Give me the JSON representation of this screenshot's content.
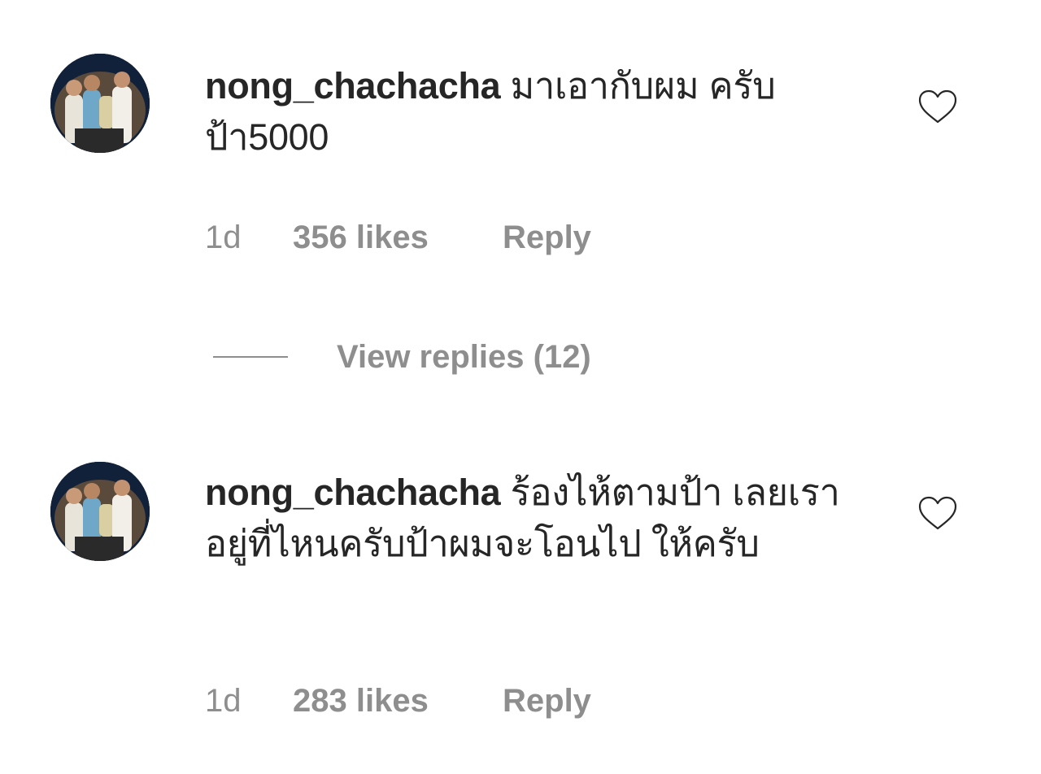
{
  "comments": [
    {
      "username": "nong_chachacha",
      "text": "มาเอากับผม ครับป้า5000",
      "time": "1d",
      "likes": "356 likes",
      "reply_label": "Reply",
      "liked": false,
      "view_replies": "View replies (12)"
    },
    {
      "username": "nong_chachacha",
      "text": "ร้องไห้ตามป้า เลยเราอยู่ที่ไหนครับป้าผมจะโอนไป ให้ครับ",
      "time": "1d",
      "likes": "283 likes",
      "reply_label": "Reply",
      "liked": false
    }
  ],
  "colors": {
    "text": "#262626",
    "secondary": "#8e8e8e",
    "background": "#ffffff"
  },
  "icons": {
    "like": "heart-outline-icon"
  }
}
